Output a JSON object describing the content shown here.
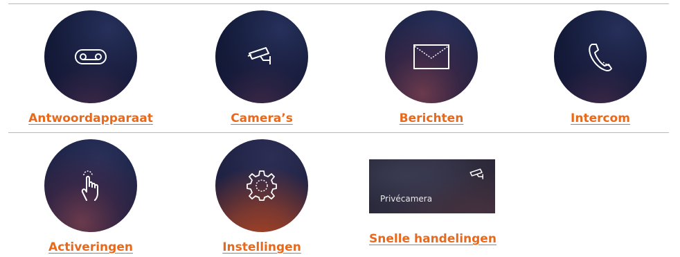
{
  "row1": [
    {
      "label": "Antwoordapparaat",
      "icon": "voicemail-icon"
    },
    {
      "label": "Camera’s",
      "icon": "security-camera-icon"
    },
    {
      "label": "Berichten",
      "icon": "envelope-icon"
    },
    {
      "label": "Intercom",
      "icon": "phone-icon"
    }
  ],
  "row2": [
    {
      "label": "Activeringen",
      "icon": "tap-hand-icon"
    },
    {
      "label": "Instellingen",
      "icon": "gear-icon"
    },
    {
      "label": "Snelle handelingen",
      "icon": "security-camera-icon"
    }
  ],
  "quick_card": {
    "title": "Privécamera",
    "icon": "security-camera-icon"
  },
  "colors": {
    "label": "#e8691b",
    "divider": "#b8b8b8"
  }
}
